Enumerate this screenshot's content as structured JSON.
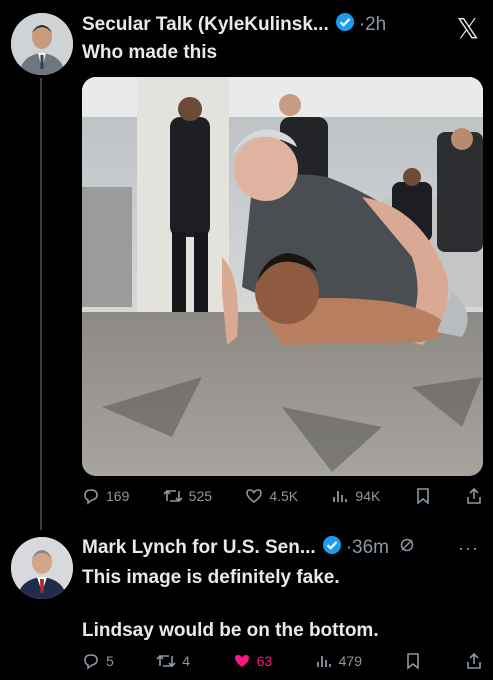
{
  "tweet1": {
    "author": "Secular Talk (KyleKulinsk...",
    "time": "·2h",
    "text": "Who made this",
    "image_alt": "",
    "actions": {
      "replies": "169",
      "reposts": "525",
      "likes": "4.5K",
      "views": "94K"
    }
  },
  "tweet2": {
    "author": "Mark Lynch for U.S. Sen...",
    "time": "·36m",
    "text_line1": "This image is definitely fake.",
    "text_line2": "Lindsay would be on the bottom.",
    "actions": {
      "replies": "5",
      "reposts": "4",
      "likes": "63",
      "views": "479"
    }
  },
  "colors": {
    "background": "#000000",
    "text": "#e7e9ea",
    "muted": "#8b98a5",
    "verified": "#1d9bf0",
    "like": "#f91880"
  },
  "icons": [
    "x-logo-icon",
    "verified-badge-icon",
    "reply-icon",
    "repost-icon",
    "like-icon",
    "views-icon",
    "bookmark-icon",
    "share-icon",
    "grok-icon",
    "more-icon"
  ]
}
